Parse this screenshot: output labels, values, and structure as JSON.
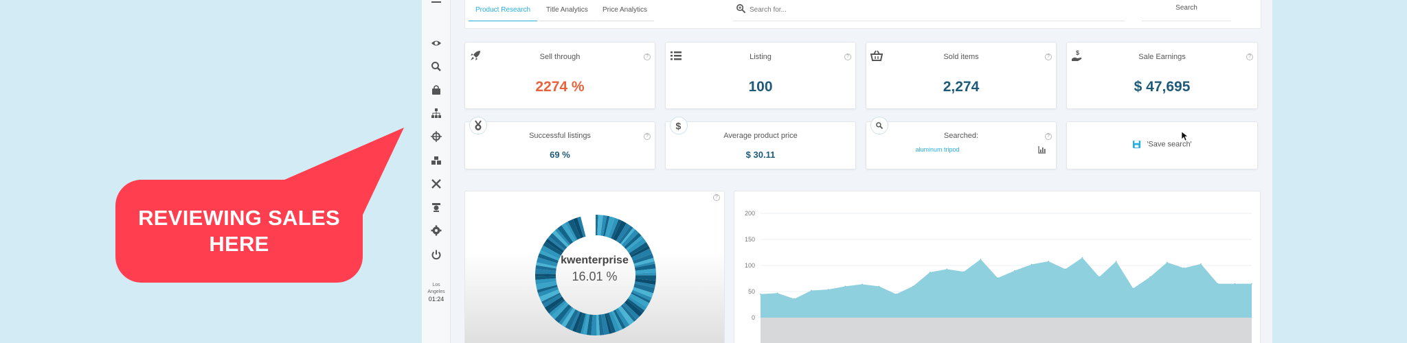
{
  "callout": {
    "text_line1": "REVIEWING SALES",
    "text_line2": "HERE",
    "color": "#ff3f4f"
  },
  "sidebar": {
    "icons": [
      "eye-icon",
      "zoom-icon",
      "bag-icon",
      "sitemap-icon",
      "crosshair-icon",
      "inventory-icon",
      "tools-icon",
      "award-icon",
      "gear-icon",
      "power-icon"
    ],
    "clock_city_1": "Los",
    "clock_city_2": "Angeles",
    "clock_time": "01:24"
  },
  "tabs": [
    {
      "label": "Product Research",
      "active": true
    },
    {
      "label": "Title Analytics",
      "active": false
    },
    {
      "label": "Price Analytics",
      "active": false
    }
  ],
  "search": {
    "placeholder": "Search for...",
    "button": "Search"
  },
  "metrics": [
    {
      "title": "Sell through",
      "value": "2274 %",
      "icon": "rocket-icon",
      "value_color": "#e8623c"
    },
    {
      "title": "Listing",
      "value": "100",
      "icon": "list-icon"
    },
    {
      "title": "Sold items",
      "value": "2,274",
      "icon": "basket-icon"
    },
    {
      "title": "Sale Earnings",
      "value": "$ 47,695",
      "icon": "money-hand-icon"
    }
  ],
  "metrics2": [
    {
      "title": "Successful listings",
      "value": "69 %",
      "icon": "medal-icon"
    },
    {
      "title": "Average product price",
      "value": "$ 30.11",
      "icon": "dollar-icon"
    },
    {
      "title": "Searched:",
      "link": "aluminum tripod",
      "icon": "search-icon"
    },
    {
      "action": "'Save search'",
      "icon": "save-icon"
    }
  ],
  "donut": {
    "name": "kwenterprise",
    "pct": "16.01 %"
  },
  "chart_data": {
    "type": "area",
    "y_ticks": [
      "200",
      "150",
      "100",
      "50",
      "0"
    ],
    "ylim": [
      0,
      200
    ],
    "grid": true,
    "values": [
      45,
      47,
      36,
      52,
      54,
      60,
      64,
      60,
      45,
      60,
      87,
      93,
      88,
      112,
      76,
      90,
      102,
      108,
      93,
      115,
      78,
      108,
      56,
      78,
      106,
      95,
      103,
      65,
      65,
      65
    ],
    "color": "#8fd0df"
  }
}
